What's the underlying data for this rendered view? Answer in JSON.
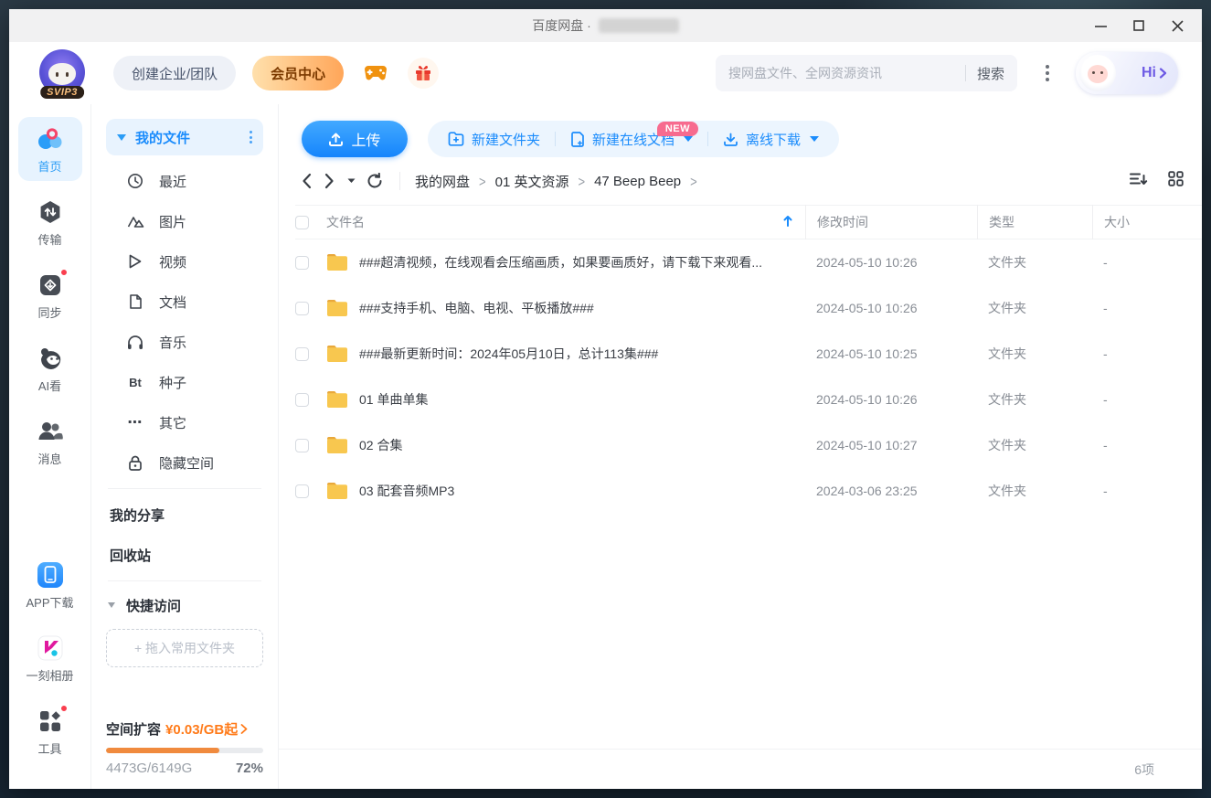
{
  "window": {
    "title": "百度网盘 ·"
  },
  "header": {
    "logo_badge": "SVIP3",
    "create_team_label": "创建企业/团队",
    "member_center_label": "会员中心",
    "search": {
      "placeholder": "搜网盘文件、全网资源资讯",
      "button_label": "搜索"
    },
    "greeting": "Hi"
  },
  "rail": {
    "items": [
      {
        "label": "首页",
        "icon": "netdisk-home-icon",
        "active": true
      },
      {
        "label": "传输",
        "icon": "transfer-icon"
      },
      {
        "label": "同步",
        "icon": "sync-icon",
        "badge": true
      },
      {
        "label": "AI看",
        "icon": "ai-view-icon"
      },
      {
        "label": "消息",
        "icon": "messages-icon"
      }
    ],
    "bottom_items": [
      {
        "label": "APP下载",
        "icon": "app-download-icon"
      },
      {
        "label": "一刻相册",
        "icon": "photo-album-icon"
      },
      {
        "label": "工具",
        "icon": "tools-icon",
        "badge": true
      }
    ]
  },
  "sidebar": {
    "my_files_label": "我的文件",
    "categories": [
      {
        "label": "最近",
        "icon": "clock-icon"
      },
      {
        "label": "图片",
        "icon": "image-icon"
      },
      {
        "label": "视频",
        "icon": "video-icon"
      },
      {
        "label": "文档",
        "icon": "document-icon"
      },
      {
        "label": "音乐",
        "icon": "music-icon"
      },
      {
        "label": "种子",
        "icon": "bt-icon",
        "icon_text": "Bt"
      },
      {
        "label": "其它",
        "icon": "more-dots-icon",
        "icon_text": "⋯"
      },
      {
        "label": "隐藏空间",
        "icon": "lock-icon"
      }
    ],
    "links": [
      {
        "label": "我的分享"
      },
      {
        "label": "回收站"
      }
    ],
    "quick_access_label": "快捷访问",
    "drop_hint": "+ 拖入常用文件夹",
    "storage": {
      "expand_label": "空间扩容",
      "price": "¥0.03/GB起",
      "usage": "4473G/6149G",
      "percent": "72%",
      "fill_width": "width:72%"
    }
  },
  "toolbar": {
    "upload_label": "上传",
    "new_folder_label": "新建文件夹",
    "new_doc_label": "新建在线文档",
    "new_badge": "NEW",
    "offline_download_label": "离线下载"
  },
  "breadcrumb": {
    "items": [
      "我的网盘",
      "01 英文资源",
      "47 Beep Beep"
    ]
  },
  "table": {
    "headers": {
      "name": "文件名",
      "modified": "修改时间",
      "type": "类型",
      "size": "大小"
    },
    "rows": [
      {
        "name": "###超清视频，在线观看会压缩画质，如果要画质好，请下载下来观看...",
        "modified": "2024-05-10 10:26",
        "type": "文件夹",
        "size": "-"
      },
      {
        "name": "###支持手机、电脑、电视、平板播放###",
        "modified": "2024-05-10 10:26",
        "type": "文件夹",
        "size": "-"
      },
      {
        "name": "###最新更新时间：2024年05月10日，总计113集###",
        "modified": "2024-05-10 10:25",
        "type": "文件夹",
        "size": "-"
      },
      {
        "name": "01 单曲单集",
        "modified": "2024-05-10 10:26",
        "type": "文件夹",
        "size": "-"
      },
      {
        "name": "02 合集",
        "modified": "2024-05-10 10:27",
        "type": "文件夹",
        "size": "-"
      },
      {
        "name": "03 配套音频MP3",
        "modified": "2024-03-06 23:25",
        "type": "文件夹",
        "size": "-"
      }
    ]
  },
  "footer": {
    "count": "6项"
  },
  "colors": {
    "accent": "#1b8cfc",
    "orange": "#ff7b1a",
    "badge_pink": "#f76b8f",
    "folder_yellow": "#f8c74f",
    "progress_fill": "#f08a3e"
  }
}
